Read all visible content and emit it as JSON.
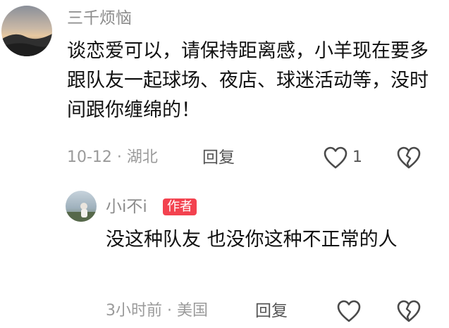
{
  "comment": {
    "username": "三千烦恼",
    "text": "谈恋爱可以，请保持距离感，小羊现在要多跟队友一起球场、夜店、球迷活动等，没时间跟你缠绵的！",
    "meta": "10-12 · 湖北",
    "reply_label": "回复",
    "like_count": "1",
    "icons": [
      "heart-outline-icon",
      "broken-heart-icon"
    ]
  },
  "reply": {
    "username": "小i不i",
    "badge": "作者",
    "text": "没这种队友 也没你这种不正常的人",
    "meta": "3小时前 · 美国",
    "reply_label": "回复",
    "icons": [
      "heart-outline-icon",
      "broken-heart-icon"
    ]
  },
  "colors": {
    "badge": "#f3424f",
    "meta_text": "#9a9a9a",
    "username": "#8c8c8c"
  }
}
